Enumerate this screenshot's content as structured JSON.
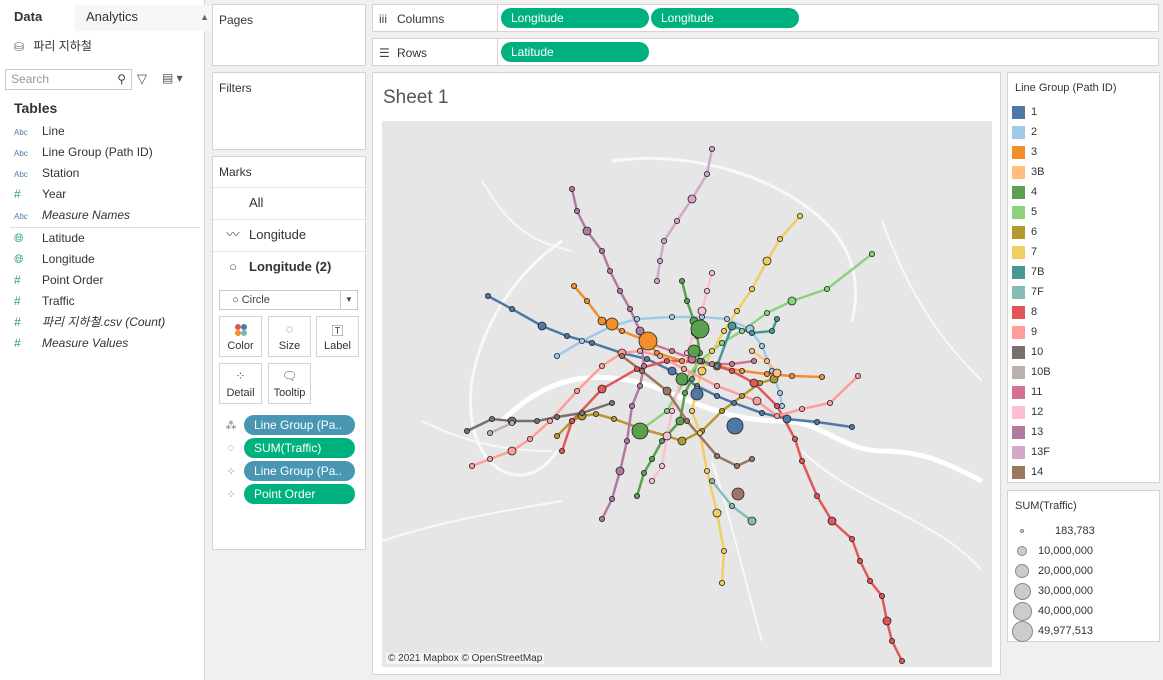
{
  "tabs": {
    "data": "Data",
    "analytics": "Analytics"
  },
  "datasource": "파리 지하철",
  "search": {
    "placeholder": "Search"
  },
  "tables_heading": "Tables",
  "fields": [
    {
      "type": "Abc",
      "name": "Line"
    },
    {
      "type": "Abc",
      "name": "Line Group (Path ID)"
    },
    {
      "type": "Abc",
      "name": "Station"
    },
    {
      "type": "#",
      "name": "Year"
    },
    {
      "type": "Abc",
      "name": "Measure Names"
    },
    {
      "type": "geo",
      "name": "Latitude"
    },
    {
      "type": "geo",
      "name": "Longitude"
    },
    {
      "type": "#",
      "name": "Point Order"
    },
    {
      "type": "#",
      "name": "Traffic"
    },
    {
      "type": "#",
      "name": "파리 지하철.csv (Count)"
    },
    {
      "type": "#",
      "name": "Measure Values"
    }
  ],
  "pages_title": "Pages",
  "filters_title": "Filters",
  "marks": {
    "title": "Marks",
    "all": "All",
    "row1": "Longitude",
    "row2": "Longitude (2)",
    "mark_type": "Circle",
    "buttons": {
      "color": "Color",
      "size": "Size",
      "label": "Label",
      "detail": "Detail",
      "tooltip": "Tooltip"
    },
    "pills": [
      "Line Group (Pa..",
      "SUM(Traffic)",
      "Line Group (Pa..",
      "Point Order"
    ]
  },
  "columns": {
    "label": "Columns",
    "pills": [
      "Longitude",
      "Longitude"
    ]
  },
  "rows": {
    "label": "Rows",
    "pills": [
      "Latitude"
    ]
  },
  "sheet": {
    "title": "Sheet 1",
    "copyright": "© 2021 Mapbox © OpenStreetMap"
  },
  "legend": {
    "title": "Line Group (Path ID)",
    "items": [
      {
        "label": "1",
        "color": "#4e79a7"
      },
      {
        "label": "2",
        "color": "#a0cbe8"
      },
      {
        "label": "3",
        "color": "#f28e2b"
      },
      {
        "label": "3B",
        "color": "#ffbe7d"
      },
      {
        "label": "4",
        "color": "#59a14f"
      },
      {
        "label": "5",
        "color": "#8cd17d"
      },
      {
        "label": "6",
        "color": "#b6992d"
      },
      {
        "label": "7",
        "color": "#f1ce63"
      },
      {
        "label": "7B",
        "color": "#499894"
      },
      {
        "label": "7F",
        "color": "#86bcb6"
      },
      {
        "label": "8",
        "color": "#e15759"
      },
      {
        "label": "9",
        "color": "#ff9d9a"
      },
      {
        "label": "10",
        "color": "#79706e"
      },
      {
        "label": "10B",
        "color": "#bab0ac"
      },
      {
        "label": "11",
        "color": "#d37295"
      },
      {
        "label": "12",
        "color": "#fabfd2"
      },
      {
        "label": "13",
        "color": "#b07aa1"
      },
      {
        "label": "13F",
        "color": "#d4a6c8"
      },
      {
        "label": "14",
        "color": "#9d7660"
      }
    ]
  },
  "size_legend": {
    "title": "SUM(Traffic)",
    "items": [
      "183,783",
      "10,000,000",
      "20,000,000",
      "30,000,000",
      "40,000,000",
      "49,977,513"
    ]
  }
}
